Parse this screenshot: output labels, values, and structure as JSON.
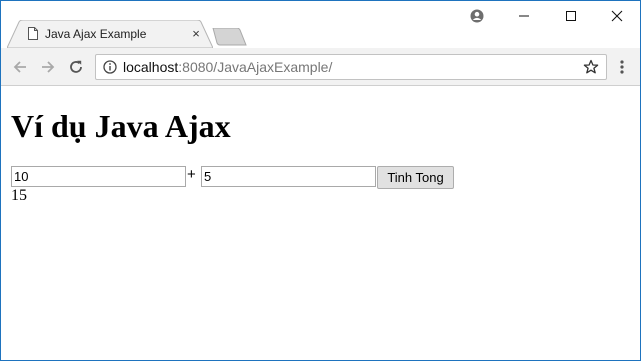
{
  "tab": {
    "title": "Java Ajax Example",
    "close_glyph": "×"
  },
  "address_bar": {
    "host": "localhost",
    "path": ":8080/JavaAjaxExample/"
  },
  "page": {
    "heading": "Ví dụ Java Ajax",
    "input_a": "10",
    "plus": "+",
    "input_b": "5",
    "button_label": "Tinh Tong",
    "result": "15"
  },
  "icons": [
    "page-icon",
    "account-icon",
    "minimize-icon",
    "maximize-icon",
    "close-icon",
    "back-icon",
    "forward-icon",
    "reload-icon",
    "info-icon",
    "star-icon",
    "menu-icon"
  ],
  "colors": {
    "window_border": "#1e73be",
    "toolbar_bg": "#f2f2f2",
    "tab_bg": "#f2f2f2"
  }
}
